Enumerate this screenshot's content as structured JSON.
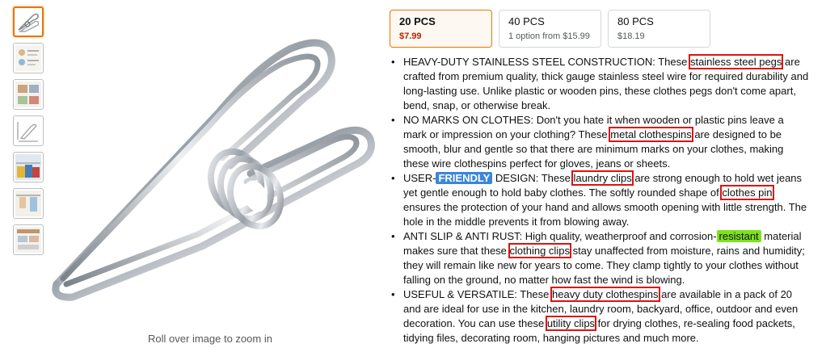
{
  "gallery": {
    "thumbnails": [
      {
        "name": "clip-photo",
        "selected": true
      },
      {
        "name": "feature-infographic"
      },
      {
        "name": "usage-infographic"
      },
      {
        "name": "dimension-diagram"
      },
      {
        "name": "lifestyle-photo"
      },
      {
        "name": "hanging-photo"
      },
      {
        "name": "comparison-infographic"
      }
    ],
    "zoom_hint": "Roll over image to zoom in"
  },
  "variations": [
    {
      "name": "20 PCS",
      "price": "$7.99",
      "selected": true
    },
    {
      "name": "40 PCS",
      "price": "1 option from $15.99"
    },
    {
      "name": "80 PCS",
      "price": "$18.19"
    }
  ],
  "bullets": [
    {
      "pre": "HEAVY-DUTY STAINLESS STEEL CONSTRUCTION: These ",
      "highlight": "stainless steel pegs",
      "post": " are crafted from premium quality, thick gauge stainless steel wire for required durability and long-lasting use. Unlike plastic or wooden pins, these clothes pegs don't come apart, bend, snap, or otherwise break."
    },
    {
      "pre": "NO MARKS ON CLOTHES: Don't you hate it when wooden or plastic pins leave a mark or impression on your clothing? These ",
      "highlight": "metal clothespins",
      "post": " are designed to be smooth, blur and gentle so that there are minimum marks on your clothes, making these wire clothespins perfect for gloves, jeans or sheets."
    },
    {
      "pre1": "USER-",
      "badge": "FRIENDLY",
      "pre2": " DESIGN: These ",
      "highlight1": "laundry clips",
      "mid": " are strong enough to hold wet jeans yet gentle enough to hold baby clothes. The softly rounded shape of ",
      "highlight2": "clothes pin",
      "post": " ensures the protection of your hand and allows smooth opening with little strength. The hole in the middle prevents it from blowing away."
    },
    {
      "pre": "ANTI SLIP & ANTI RUST: High quality, weatherproof and corrosion-",
      "badge": "resistant",
      "mid": " material makes sure that these ",
      "highlight": "clothing clips",
      "post": " stay unaffected from moisture, rains and humidity; they will remain like new for years to come. They clamp tightly to your clothes without falling on the ground, no matter how fast the wind is blowing."
    },
    {
      "pre": "USEFUL & VERSATILE: These ",
      "highlight1": "heavy duty clothespins",
      "mid": " are available in a pack of 20 and are ideal for use in the kitchen, laundry room, backyard, office, outdoor and even decoration. You can use these ",
      "highlight2": "utility clips",
      "post": " for drying clothes, re-sealing food packets, tidying files, decorating room, hanging pictures and much more."
    }
  ],
  "colors": {
    "selected_border": "#e77600",
    "price_selected": "#b12704",
    "highlight_box": "#e01010",
    "badge_blue": "#3b86d8",
    "badge_green": "#7ee21b"
  }
}
